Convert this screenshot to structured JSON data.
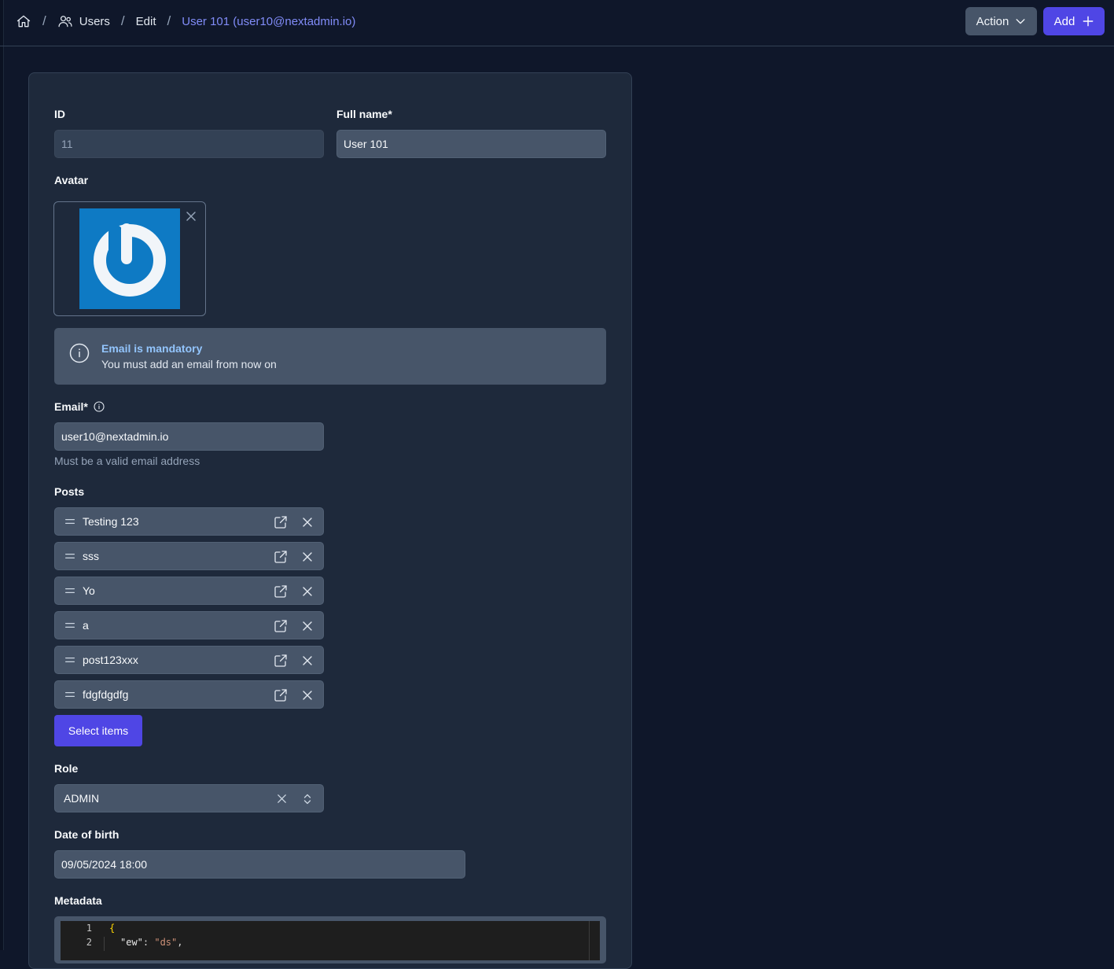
{
  "breadcrumb": {
    "users": "Users",
    "edit": "Edit",
    "current": "User 101 (user10@nextadmin.io)",
    "separator": "/"
  },
  "header": {
    "action_label": "Action",
    "add_label": "Add"
  },
  "form": {
    "id_label": "ID",
    "id_value": "11",
    "fullname_label": "Full name*",
    "fullname_value": "User 101",
    "avatar_label": "Avatar",
    "alert_title": "Email is mandatory",
    "alert_text": "You must add an email from now on",
    "email_label": "Email*",
    "email_value": "user10@nextadmin.io",
    "email_help": "Must be a valid email address",
    "posts_label": "Posts",
    "posts": [
      "Testing 123",
      "sss",
      "Yo",
      "a",
      "post123xxx",
      "fdgfdgdfg"
    ],
    "select_items_label": "Select items",
    "role_label": "Role",
    "role_value": "ADMIN",
    "dob_label": "Date of birth",
    "dob_value": "09/05/2024 18:00",
    "metadata_label": "Metadata"
  },
  "metadata_editor": {
    "line_numbers": [
      "1",
      "2"
    ],
    "line1": "{",
    "line2_key": "\"ew\"",
    "line2_colon": ": ",
    "line2_value": "\"ds\"",
    "line2_comma": ","
  },
  "colors": {
    "background": "#0f172a",
    "card": "#1e293b",
    "input": "#475569",
    "primary": "#4f46e5",
    "breadcrumb_current": "#818cf8",
    "alert_title": "#93c5fd",
    "avatar_bg": "#0e7ac4"
  },
  "icons": {
    "home": "home-icon",
    "users": "users-icon",
    "chevron": "chevron-down-icon",
    "plus": "plus-icon",
    "info": "info-icon",
    "drag": "drag-handle-icon",
    "external": "external-link-icon",
    "close": "close-icon",
    "updown": "chevron-updown-icon"
  }
}
